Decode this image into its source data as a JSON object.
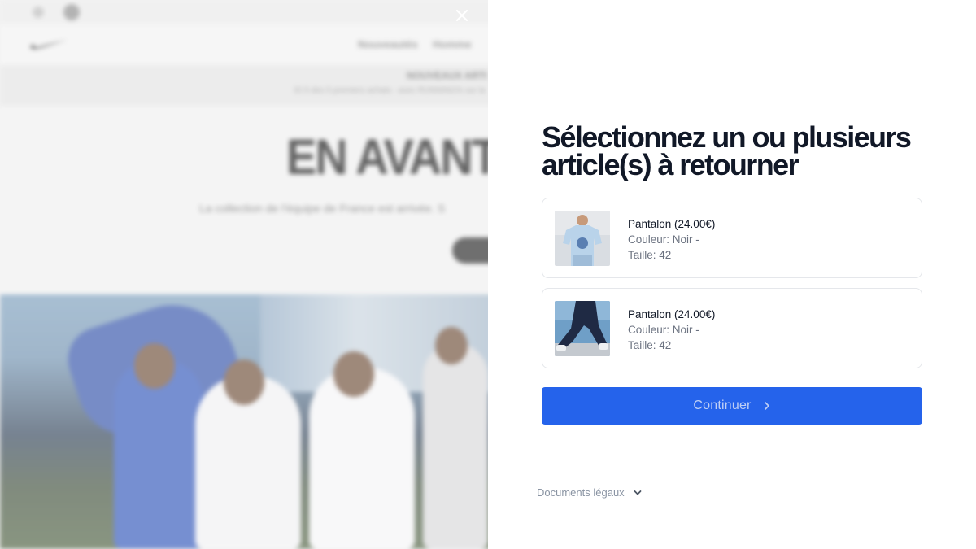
{
  "background": {
    "nav_items": [
      "Nouveautés",
      "Homme"
    ],
    "banner_title": "NOUVEAUX ARTI",
    "banner_subtitle": "Et 5 des 5 premiers achats - avec RUNNING% sur la",
    "headline": "EN AVANT.",
    "subheadline": "La collection de l'équipe de France est arrivée. S"
  },
  "modal": {
    "title": "Sélectionnez un ou plusieurs article(s) à retourner",
    "items": [
      {
        "name": "Pantalon (24.00€)",
        "color_line": "Couleur: Noir -",
        "size_line": "Taille: 42",
        "thumbnail": "tshirt-photo"
      },
      {
        "name": "Pantalon (24.00€)",
        "color_line": "Couleur: Noir -",
        "size_line": "Taille: 42",
        "thumbnail": "pants-photo"
      }
    ],
    "continue_label": "Continuer",
    "legal_label": "Documents légaux"
  },
  "colors": {
    "primary": "#2563eb",
    "primary_text": "#bfcff5",
    "title_text": "#111827",
    "muted_text": "#6b7280",
    "card_border": "#e5e7eb"
  },
  "icons": {
    "close": "close-icon",
    "continue": "chevron-right-icon",
    "legal": "chevron-down-icon"
  }
}
